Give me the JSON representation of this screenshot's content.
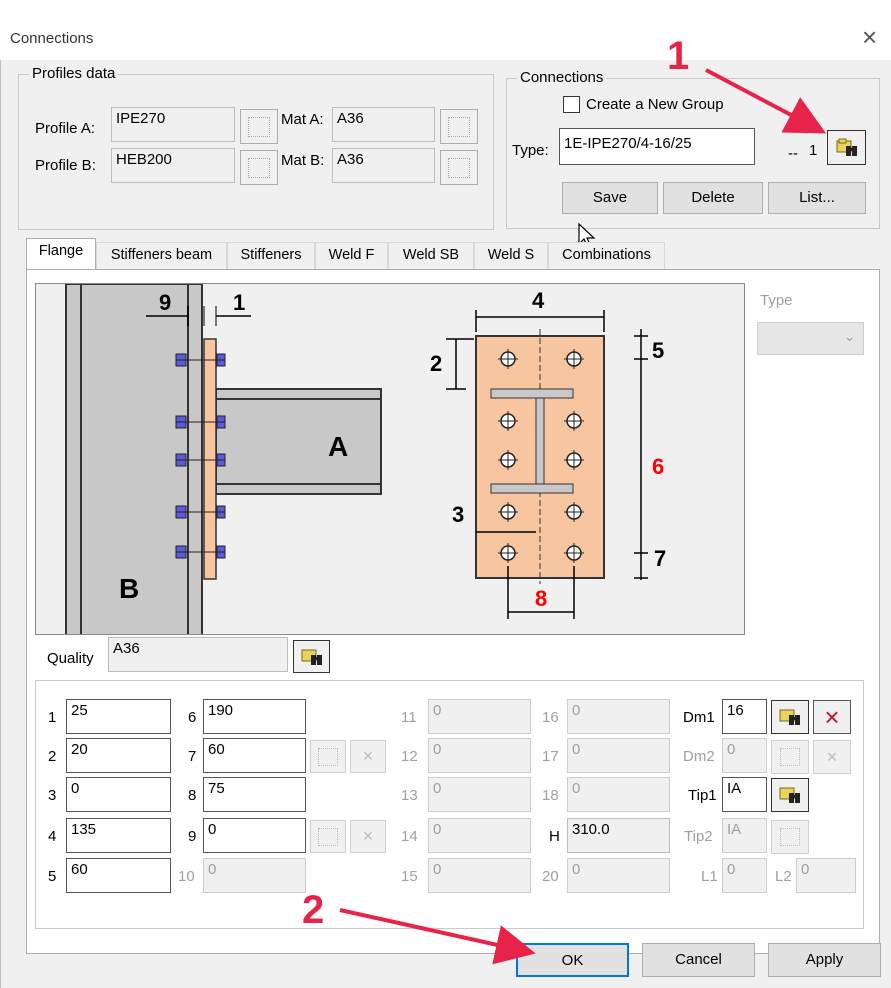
{
  "window": {
    "title": "Connections",
    "close_glyph": "×"
  },
  "profiles": {
    "group_title": "Profiles data",
    "profile_a_label": "Profile A:",
    "profile_a": "IPE270",
    "profile_b_label": "Profile B:",
    "profile_b": "HEB200",
    "mat_a_label": "Mat A:",
    "mat_a": "A36",
    "mat_b_label": "Mat B:",
    "mat_b": "A36"
  },
  "connections": {
    "group_title": "Connections",
    "create_group_label": "Create a New Group",
    "type_label": "Type:",
    "type_value": "1E-IPE270/4-16/25",
    "dash": "--",
    "count": "1",
    "save_label": "Save",
    "delete_label": "Delete",
    "list_label": "List..."
  },
  "tabs": [
    {
      "label": "Flange",
      "active": true
    },
    {
      "label": "Stiffeners beam"
    },
    {
      "label": "Stiffeners"
    },
    {
      "label": "Weld F"
    },
    {
      "label": "Weld SB"
    },
    {
      "label": "Weld S"
    },
    {
      "label": "Combinations"
    }
  ],
  "diagram": {
    "dim_1": "1",
    "dim_2": "2",
    "dim_3": "3",
    "dim_4": "4",
    "dim_5": "5",
    "dim_6": "6",
    "dim_7": "7",
    "dim_8": "8",
    "dim_9": "9",
    "label_a": "A",
    "label_b": "B",
    "red_color": "#ff0000",
    "plate_color": "#f7c59f",
    "steel_color": "#c8c8c8",
    "bolt_color": "#5a5adc"
  },
  "type_select": {
    "label": "Type",
    "value": ""
  },
  "quality": {
    "label": "Quality",
    "value": "A36"
  },
  "params": {
    "l1": "1",
    "v1": "25",
    "l2": "2",
    "v2": "20",
    "l3": "3",
    "v3": "0",
    "l4": "4",
    "v4": "135",
    "l5": "5",
    "v5": "60",
    "l6": "6",
    "v6": "190",
    "l7": "7",
    "v7": "60",
    "l8": "8",
    "v8": "75",
    "l9": "9",
    "v9": "0",
    "l10": "10",
    "v10": "0",
    "l11": "11",
    "v11": "0",
    "l12": "12",
    "v12": "0",
    "l13": "13",
    "v13": "0",
    "l14": "14",
    "v14": "0",
    "l15": "15",
    "v15": "0",
    "l16": "16",
    "v16": "0",
    "l17": "17",
    "v17": "0",
    "l18": "18",
    "v18": "0",
    "lh": "H",
    "vh": "310.0",
    "l20": "20",
    "v20": "0",
    "dm1_label": "Dm1",
    "dm1": "16",
    "dm2_label": "Dm2",
    "dm2": "0",
    "tip1_label": "Tip1",
    "tip1": "IA",
    "tip2_label": "Tip2",
    "tip2": "IA",
    "l1b_label": "L1",
    "l1b": "0",
    "l2b_label": "L2",
    "l2b": "0"
  },
  "annotations": {
    "marker_1": "1",
    "marker_2": "2",
    "arrow_color": "#e8234a"
  },
  "footer": {
    "ok_label": "OK",
    "cancel_label": "Cancel",
    "apply_label": "Apply"
  }
}
